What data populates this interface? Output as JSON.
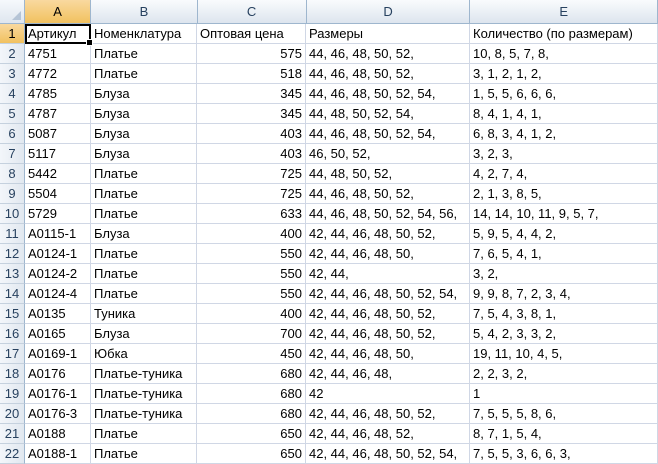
{
  "columns": [
    "A",
    "B",
    "C",
    "D",
    "E"
  ],
  "rows": [
    {
      "n": "1",
      "a": "Артикул",
      "b": "Номенклатура",
      "c": "Оптовая цена",
      "d": "Размеры",
      "e": "Количество (по размерам)"
    },
    {
      "n": "2",
      "a": "4751",
      "b": "Платье",
      "c": "575",
      "d": "44, 46, 48, 50, 52,",
      "e": "10, 8, 5, 7, 8,"
    },
    {
      "n": "3",
      "a": "4772",
      "b": "Платье",
      "c": "518",
      "d": "44, 46, 48, 50, 52,",
      "e": "3, 1, 2, 1, 2,"
    },
    {
      "n": "4",
      "a": "4785",
      "b": "Блуза",
      "c": "345",
      "d": "44, 46, 48, 50, 52, 54,",
      "e": "1, 5, 5, 6, 6, 6,"
    },
    {
      "n": "5",
      "a": "4787",
      "b": "Блуза",
      "c": "345",
      "d": "44, 48, 50, 52, 54,",
      "e": "8, 4, 1, 4, 1,"
    },
    {
      "n": "6",
      "a": "5087",
      "b": "Блуза",
      "c": "403",
      "d": "44, 46, 48, 50, 52, 54,",
      "e": "6, 8, 3, 4, 1, 2,"
    },
    {
      "n": "7",
      "a": "5117",
      "b": "Блуза",
      "c": "403",
      "d": "46, 50, 52,",
      "e": "3, 2, 3,"
    },
    {
      "n": "8",
      "a": "5442",
      "b": "Платье",
      "c": "725",
      "d": "44, 48, 50, 52,",
      "e": "4, 2, 7, 4,"
    },
    {
      "n": "9",
      "a": "5504",
      "b": "Платье",
      "c": "725",
      "d": "44, 46, 48, 50, 52,",
      "e": "2, 1, 3, 8, 5,"
    },
    {
      "n": "10",
      "a": "5729",
      "b": "Платье",
      "c": "633",
      "d": "44, 46, 48, 50, 52, 54, 56,",
      "e": "14, 14, 10, 11, 9, 5, 7,"
    },
    {
      "n": "11",
      "a": "A0115-1",
      "b": "Блуза",
      "c": "400",
      "d": "42, 44, 46, 48, 50, 52,",
      "e": "5, 9, 5, 4, 4, 2,"
    },
    {
      "n": "12",
      "a": "A0124-1",
      "b": "Платье",
      "c": "550",
      "d": "42, 44, 46, 48, 50,",
      "e": "7, 6, 5, 4, 1,"
    },
    {
      "n": "13",
      "a": "A0124-2",
      "b": "Платье",
      "c": "550",
      "d": "42, 44,",
      "e": "3, 2,"
    },
    {
      "n": "14",
      "a": "A0124-4",
      "b": "Платье",
      "c": "550",
      "d": "42, 44, 46, 48, 50, 52, 54,",
      "e": "9, 9, 8, 7, 2, 3, 4,"
    },
    {
      "n": "15",
      "a": "A0135",
      "b": "Туника",
      "c": "400",
      "d": "42, 44, 46, 48, 50, 52,",
      "e": "7, 5, 4, 3, 8, 1,"
    },
    {
      "n": "16",
      "a": "A0165",
      "b": "Блуза",
      "c": "700",
      "d": "42, 44, 46, 48, 50, 52,",
      "e": "5, 4, 2, 3, 3, 2,"
    },
    {
      "n": "17",
      "a": "A0169-1",
      "b": "Юбка",
      "c": "450",
      "d": "42, 44, 46, 48, 50,",
      "e": "19, 11, 10, 4, 5,"
    },
    {
      "n": "18",
      "a": "A0176",
      "b": "Платье-туника",
      "c": "680",
      "d": "42, 44, 46, 48,",
      "e": "2, 2, 3, 2,"
    },
    {
      "n": "19",
      "a": "A0176-1",
      "b": "Платье-туника",
      "c": "680",
      "d": "42",
      "e": "1"
    },
    {
      "n": "20",
      "a": "A0176-3",
      "b": "Платье-туника",
      "c": "680",
      "d": "42, 44, 46, 48, 50, 52,",
      "e": "7, 5, 5, 5, 8, 6,"
    },
    {
      "n": "21",
      "a": "A0188",
      "b": "Платье",
      "c": "650",
      "d": "42, 44, 46, 48, 52,",
      "e": "8, 7, 1, 5, 4,"
    },
    {
      "n": "22",
      "a": "A0188-1",
      "b": "Платье",
      "c": "650",
      "d": "42, 44, 46, 48, 50, 52, 54,",
      "e": "7, 5, 5, 3, 6, 6, 3,"
    }
  ]
}
